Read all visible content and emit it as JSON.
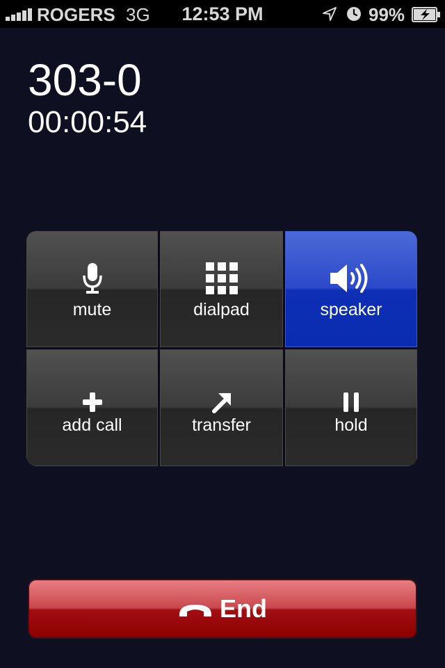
{
  "status_bar": {
    "carrier": "ROGERS",
    "network": "3G",
    "time": "12:53 PM",
    "battery_percent": "99%",
    "icons": [
      "signal-icon",
      "location-icon",
      "alarm-icon",
      "battery-charging-icon"
    ]
  },
  "call": {
    "number": "303-0",
    "duration": "00:00:54"
  },
  "controls": {
    "mute": {
      "label": "mute",
      "icon": "microphone-icon",
      "active": false
    },
    "dialpad": {
      "label": "dialpad",
      "icon": "dialpad-icon",
      "active": false
    },
    "speaker": {
      "label": "speaker",
      "icon": "speaker-icon",
      "active": true
    },
    "add_call": {
      "label": "add call",
      "icon": "plus-icon",
      "active": false
    },
    "transfer": {
      "label": "transfer",
      "icon": "arrow-up-right-icon",
      "active": false
    },
    "hold": {
      "label": "hold",
      "icon": "pause-icon",
      "active": false
    }
  },
  "end_button": {
    "label": "End",
    "icon": "hang-up-phone-icon"
  },
  "colors": {
    "background": "#0e0f21",
    "active_button": "#0e2fb5",
    "end_button": "#a10f12"
  }
}
